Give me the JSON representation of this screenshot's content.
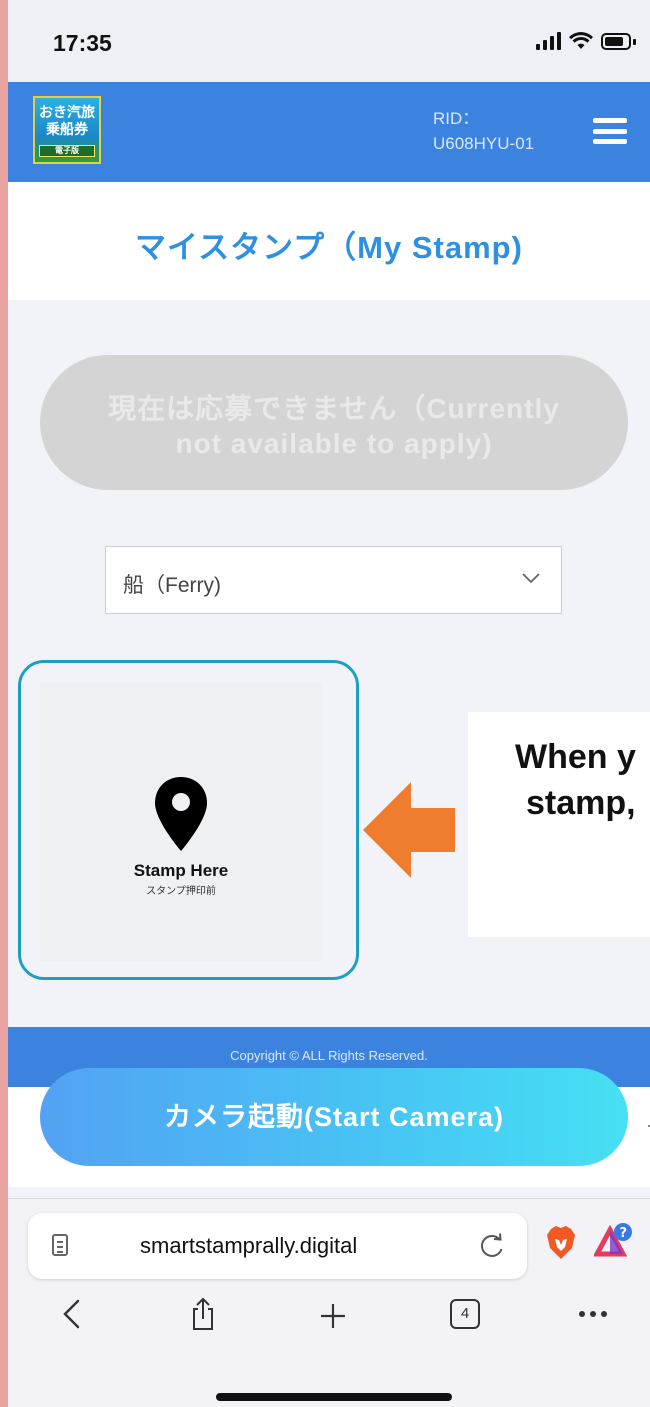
{
  "status_bar": {
    "time": "17:35"
  },
  "header": {
    "rid_label": "RID：",
    "rid_value": "U608HYU-01",
    "logo_text_top": "おき汽旅",
    "logo_text_bottom": "乗船券",
    "logo_band": "電子版"
  },
  "page": {
    "title": "マイスタンプ（My Stamp)"
  },
  "apply_button": {
    "line1": "現在は応募できません（Currently",
    "line2": "not available to apply)"
  },
  "category_select": {
    "value": "船（Ferry)"
  },
  "stamp": {
    "label": "Stamp Here",
    "sub_label": "スタンプ押印前"
  },
  "callout": {
    "line1": "When y",
    "line2": "stamp,"
  },
  "footer": {
    "copyright": "Copyright © ALL Rights Reserved."
  },
  "camera_button": {
    "label": "カメラ起動(Start Camera)"
  },
  "browser": {
    "url": "smartstamprally.digital",
    "tab_count": "4"
  },
  "colors": {
    "header_blue": "#3c83e0",
    "title_blue": "#2f8fe0",
    "stamp_frame": "#1f9fc0",
    "arrow_orange": "#ee7d2e"
  }
}
